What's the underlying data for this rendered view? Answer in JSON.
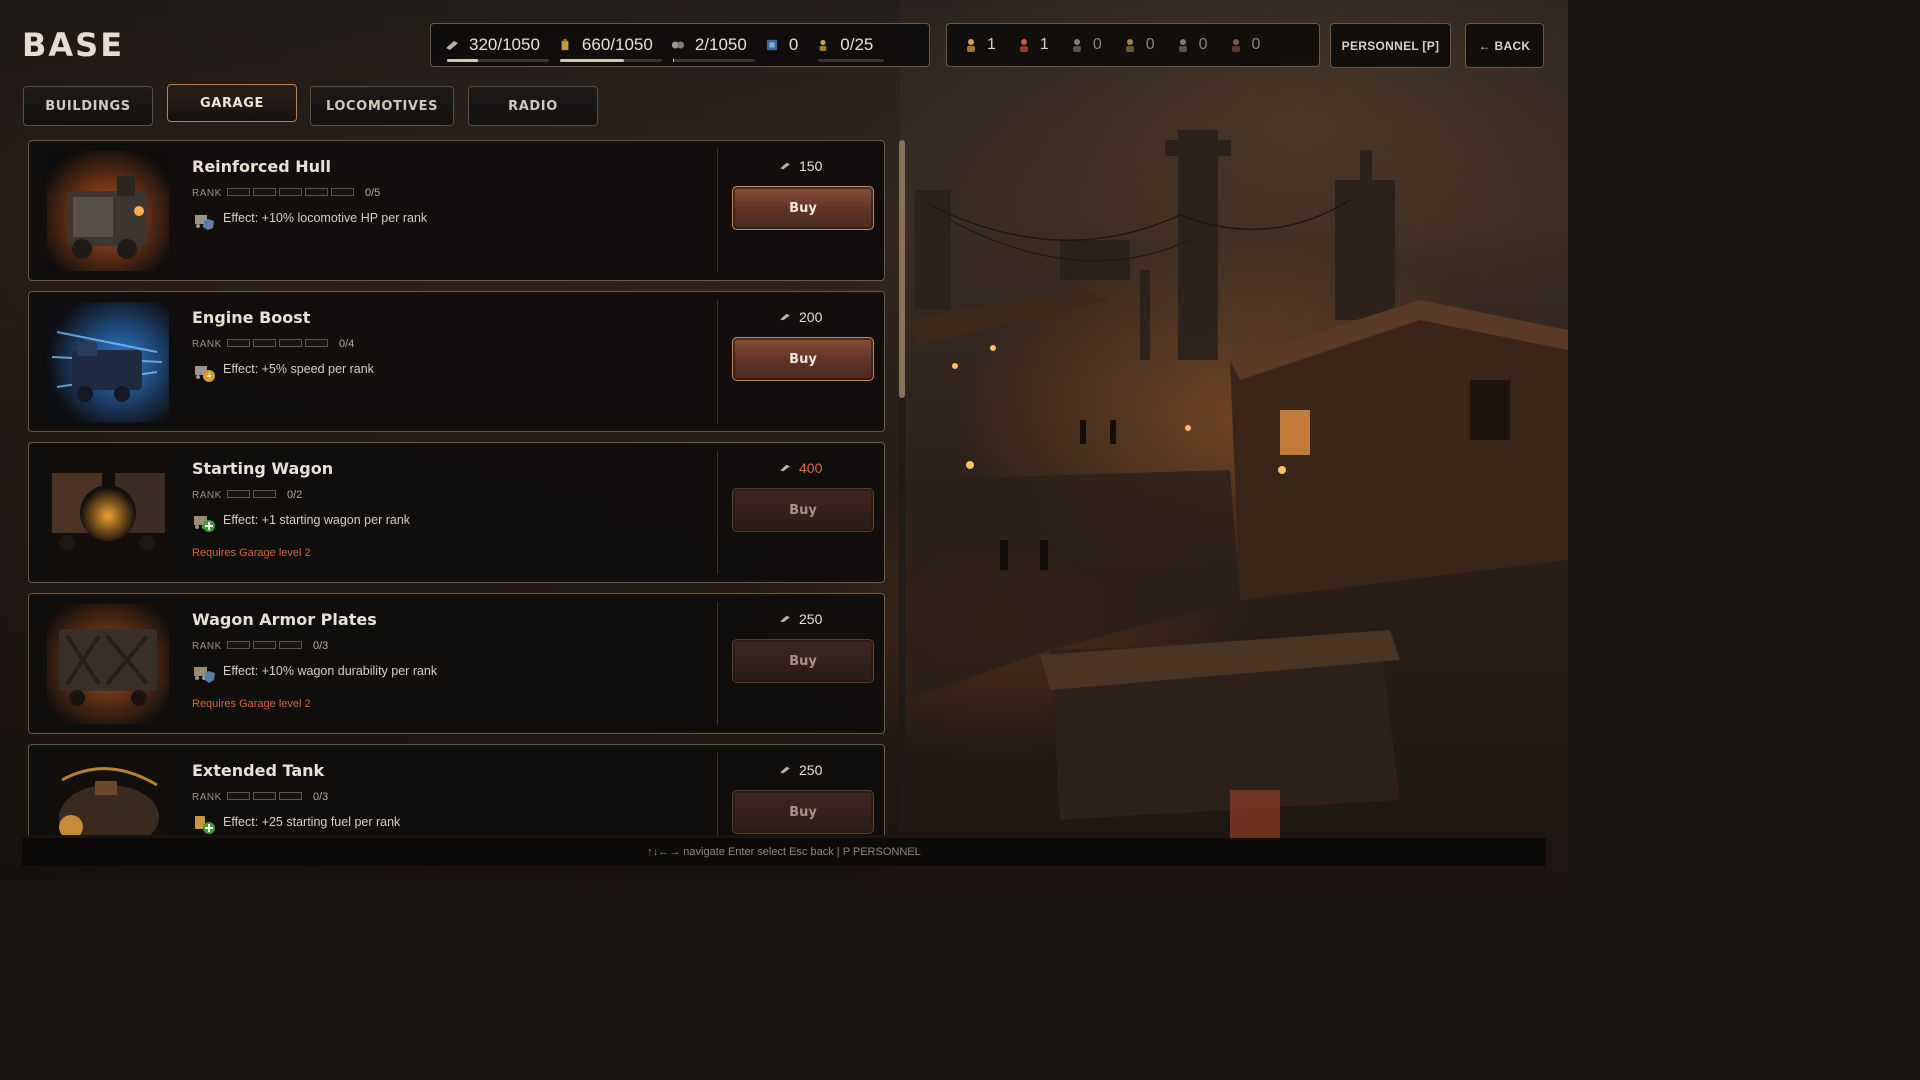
{
  "page": {
    "title": "BASE"
  },
  "resources": [
    {
      "icon": "scrap-icon",
      "value": "320/1050",
      "fill": 0.3
    },
    {
      "icon": "fuel-icon",
      "value": "660/1050",
      "fill": 0.63
    },
    {
      "icon": "parts-icon",
      "value": "2/1050",
      "fill": 0.002
    },
    {
      "icon": "crystal-icon",
      "value": "0"
    },
    {
      "icon": "population-icon",
      "value": "0/25",
      "fill": 0.0
    }
  ],
  "crew": [
    {
      "icon": "crew-worker-icon",
      "value": "1"
    },
    {
      "icon": "crew-medic-icon",
      "value": "1"
    },
    {
      "icon": "crew-soldier-icon",
      "value": "0"
    },
    {
      "icon": "crew-engineer-icon",
      "value": "0"
    },
    {
      "icon": "crew-scout-icon",
      "value": "0"
    },
    {
      "icon": "crew-mechanic-icon",
      "value": "0"
    }
  ],
  "buttons": {
    "personnel": "PERSONNEL [P]",
    "back": "← BACK"
  },
  "tabs": [
    {
      "label": "BUILDINGS",
      "active": false
    },
    {
      "label": "GARAGE",
      "active": true
    },
    {
      "label": "LOCOMOTIVES",
      "active": false
    },
    {
      "label": "RADIO",
      "active": false
    }
  ],
  "upgrades": [
    {
      "name": "Reinforced Hull",
      "rank_label": "RANK",
      "rank": "0/5",
      "pips": 5,
      "effect": "Effect: +10% locomotive HP per rank",
      "effect_icon": "locomotive-shield-icon",
      "price": "150",
      "price_affordable": true,
      "buy": "Buy",
      "buy_enabled": true,
      "requirement": "",
      "image": "armored-locomotive-image"
    },
    {
      "name": "Engine Boost",
      "rank_label": "RANK",
      "rank": "0/4",
      "pips": 4,
      "effect": "Effect: +5% speed per rank",
      "effect_icon": "locomotive-bolt-icon",
      "price": "200",
      "price_affordable": true,
      "buy": "Buy",
      "buy_enabled": true,
      "requirement": "",
      "image": "blue-speed-locomotive-image"
    },
    {
      "name": "Starting Wagon",
      "rank_label": "RANK",
      "rank": "0/2",
      "pips": 2,
      "effect": "Effect: +1 starting wagon per rank",
      "effect_icon": "wagon-plus-icon",
      "price": "400",
      "price_affordable": false,
      "buy": "Buy",
      "buy_enabled": false,
      "requirement": "Requires Garage level 2",
      "image": "wagon-coupling-image"
    },
    {
      "name": "Wagon Armor Plates",
      "rank_label": "RANK",
      "rank": "0/3",
      "pips": 3,
      "effect": "Effect: +10% wagon durability per rank",
      "effect_icon": "wagon-shield-icon",
      "price": "250",
      "price_affordable": true,
      "buy": "Buy",
      "buy_enabled": false,
      "requirement": "Requires Garage level 2",
      "image": "armored-wagon-image"
    },
    {
      "name": "Extended Tank",
      "rank_label": "RANK",
      "rank": "0/3",
      "pips": 3,
      "effect": "Effect: +25 starting fuel per rank",
      "effect_icon": "fuel-plus-icon",
      "price": "250",
      "price_affordable": true,
      "buy": "Buy",
      "buy_enabled": false,
      "requirement": "",
      "image": "fuel-tank-image"
    }
  ],
  "scroll": {
    "position": 0.0,
    "visible_fraction": 0.37
  },
  "footer": {
    "hint": "↑↓←→ navigate  Enter select  Esc back | P PERSONNEL"
  },
  "colors": {
    "accent": "#b4834e",
    "buy": "#8a4f3a",
    "warning": "#d0673d",
    "text": "#e6e0d6"
  }
}
